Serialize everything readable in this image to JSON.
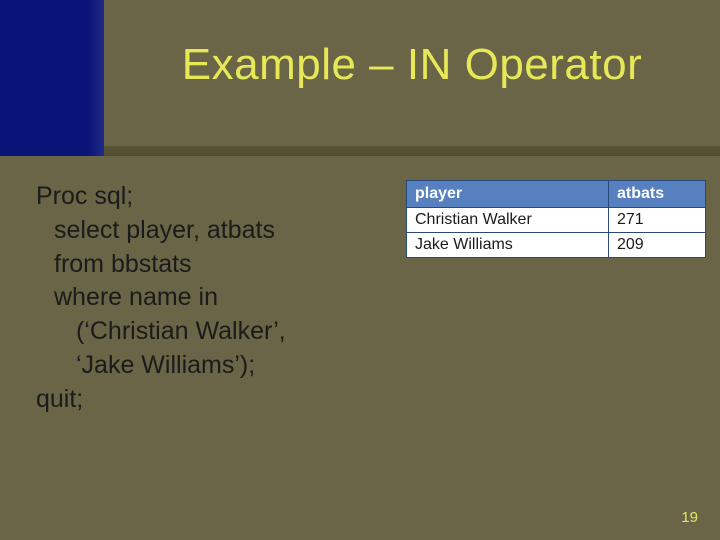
{
  "title": "Example – IN Operator",
  "code": {
    "l1": "Proc sql;",
    "l2": "select player, atbats",
    "l3": "from bbstats",
    "l4": "where name in",
    "l5": "(‘Christian Walker’,",
    "l6": "‘Jake Williams’);",
    "l7": "quit;"
  },
  "table": {
    "headers": {
      "c1": "player",
      "c2": "atbats"
    },
    "rows": [
      {
        "c1": "Christian Walker",
        "c2": "271"
      },
      {
        "c1": "Jake Williams",
        "c2": "209"
      }
    ]
  },
  "page_number": "19",
  "chart_data": {
    "type": "table",
    "columns": [
      "player",
      "atbats"
    ],
    "rows": [
      [
        "Christian Walker",
        271
      ],
      [
        "Jake Williams",
        209
      ]
    ]
  }
}
